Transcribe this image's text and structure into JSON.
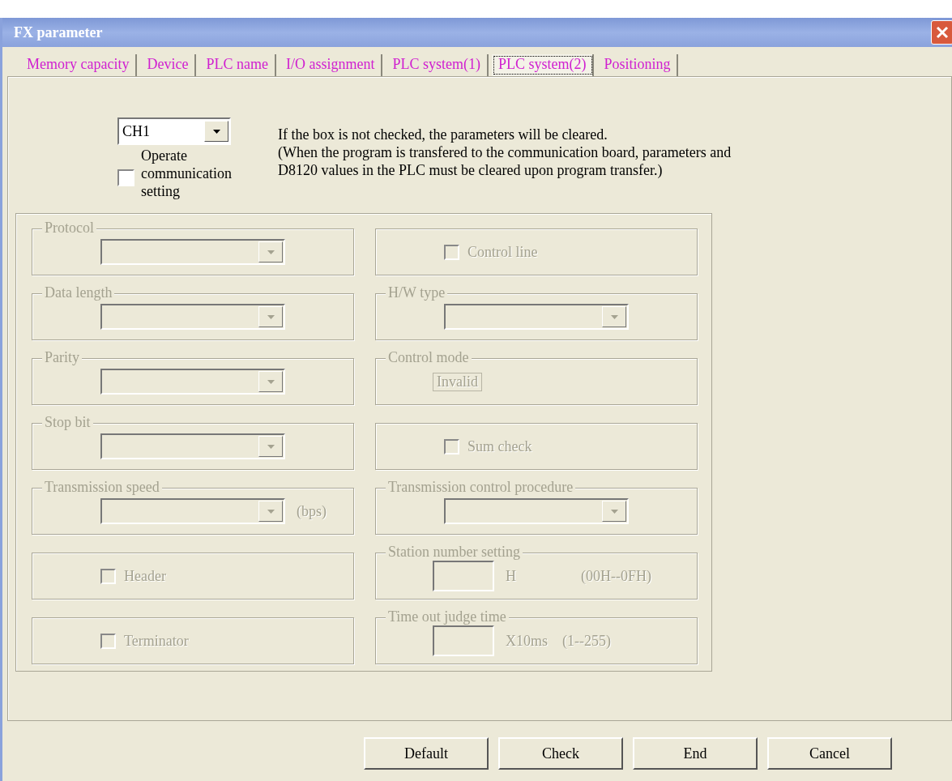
{
  "window": {
    "title": "FX parameter"
  },
  "tabs": [
    {
      "label": "Memory capacity",
      "selected": false
    },
    {
      "label": "Device",
      "selected": false
    },
    {
      "label": "PLC name",
      "selected": false
    },
    {
      "label": "I/O assignment",
      "selected": false
    },
    {
      "label": "PLC system(1)",
      "selected": false
    },
    {
      "label": "PLC system(2)",
      "selected": true
    },
    {
      "label": "Positioning",
      "selected": false
    }
  ],
  "channel": {
    "value": "CH1"
  },
  "operate_checkbox": {
    "label": "Operate communication setting",
    "checked": false
  },
  "note_lines": [
    "If the box is not checked, the parameters will be cleared.",
    "(When the program is transfered to the communication board, parameters and",
    "D8120 values in the PLC must be cleared upon program transfer.)"
  ],
  "settings": {
    "disabled": true,
    "left": [
      {
        "kind": "dropdown",
        "title": "Protocol"
      },
      {
        "kind": "dropdown",
        "title": "Data length"
      },
      {
        "kind": "dropdown",
        "title": "Parity"
      },
      {
        "kind": "dropdown",
        "title": "Stop bit"
      },
      {
        "kind": "dropdown",
        "title": "Transmission speed",
        "unit": "(bps)"
      },
      {
        "kind": "checkbox",
        "label": "Header",
        "checked": false
      },
      {
        "kind": "checkbox",
        "label": "Terminator",
        "checked": false
      }
    ],
    "right": [
      {
        "kind": "checkbox",
        "label": "Control line",
        "checked": false
      },
      {
        "kind": "dropdown",
        "title": "H/W type"
      },
      {
        "kind": "readout",
        "title": "Control mode",
        "value": "Invalid"
      },
      {
        "kind": "checkbox",
        "label": "Sum check",
        "checked": false
      },
      {
        "kind": "dropdown",
        "title": "Transmission control procedure"
      },
      {
        "kind": "input",
        "title": "Station number setting",
        "unit": "H",
        "range": "(00H--0FH)"
      },
      {
        "kind": "input",
        "title": "Time out judge time",
        "unit": "X10ms",
        "range": "(1--255)"
      }
    ]
  },
  "buttons": [
    "Default",
    "Check",
    "End",
    "Cancel"
  ]
}
